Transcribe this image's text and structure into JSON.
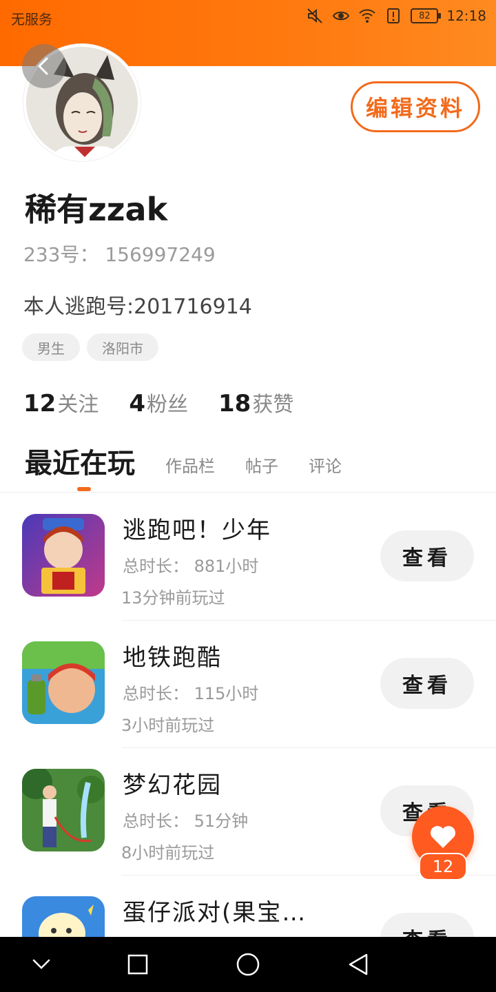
{
  "status_bar": {
    "carrier": "无服务",
    "battery": "82",
    "time": "12:18"
  },
  "profile": {
    "edit_button": "编辑资料",
    "username": "稀有zzak",
    "uid": "233号： 156997249",
    "bio": "本人逃跑号:201716914",
    "tags": [
      "男生",
      "洛阳市"
    ],
    "stats": [
      {
        "value": "12",
        "label": "关注"
      },
      {
        "value": "4",
        "label": "粉丝"
      },
      {
        "value": "18",
        "label": "获赞"
      }
    ]
  },
  "tabs": [
    {
      "label": "最近在玩",
      "active": true
    },
    {
      "label": "作品栏",
      "active": false
    },
    {
      "label": "帖子",
      "active": false
    },
    {
      "label": "评论",
      "active": false
    }
  ],
  "games": [
    {
      "name": "逃跑吧！少年",
      "total": "总时长： 881小时",
      "last": "13分钟前玩过",
      "button": "查看",
      "icon": "escape-game-icon"
    },
    {
      "name": "地铁跑酷",
      "total": "总时长： 115小时",
      "last": "3小时前玩过",
      "button": "查看",
      "icon": "subway-surfers-icon"
    },
    {
      "name": "梦幻花园",
      "total": "总时长： 51分钟",
      "last": "8小时前玩过",
      "button": "查看",
      "icon": "gardenscapes-icon"
    },
    {
      "name": "蛋仔派对(果宝…",
      "total": "",
      "last": "",
      "button": "查看",
      "icon": "eggy-party-icon"
    }
  ],
  "like": {
    "count": "12"
  },
  "colors": {
    "accent": "#f26a1b",
    "status_gradient_start": "#ff6a00",
    "status_gradient_end": "#ff8a20",
    "fab": "#ff5a1f"
  }
}
